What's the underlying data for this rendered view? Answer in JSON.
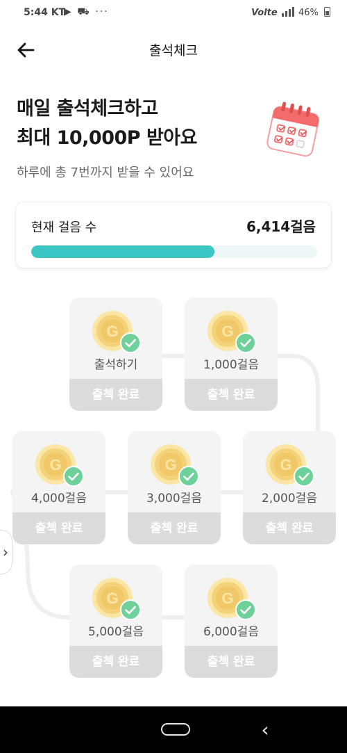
{
  "status_bar": {
    "time": "5:44 KT",
    "icons_left": "▶ ⛟  ···",
    "carrier": "Volte",
    "battery_percent": "46%"
  },
  "header": {
    "back_icon": "arrow-left-icon",
    "title": "출석체크"
  },
  "hero": {
    "title_line1": "매일 출석체크하고",
    "title_line2": "최대 10,000P 받아요",
    "subtitle": "하루에 총 7번까지 받을 수 있어요",
    "illustration_icon": "calendar-icon"
  },
  "steps": {
    "label": "현재 걸음 수",
    "value": "6,414걸음",
    "progress": 0.64,
    "progress_color": "#3cc6c4"
  },
  "nodes": [
    {
      "label": "출석하기",
      "button": "출첵 완료",
      "status": "completed"
    },
    {
      "label": "1,000걸음",
      "button": "출첵 완료",
      "status": "completed"
    },
    {
      "label": "2,000걸음",
      "button": "출첵 완료",
      "status": "completed"
    },
    {
      "label": "3,000걸음",
      "button": "출첵 완료",
      "status": "completed"
    },
    {
      "label": "4,000걸음",
      "button": "출첵 완료",
      "status": "completed"
    },
    {
      "label": "5,000걸음",
      "button": "출첵 완료",
      "status": "completed"
    },
    {
      "label": "6,000걸음",
      "button": "출첵 완료",
      "status": "completed"
    }
  ],
  "colors": {
    "accent": "#3cc6c4",
    "check": "#6fd19a",
    "coin": "#f3d27a",
    "completed_button": "#dcdcdc"
  },
  "side_tab_icon": "chevron-right-icon",
  "nav": {
    "home_icon": "home-pill-icon",
    "back_icon": "chevron-left-icon"
  }
}
